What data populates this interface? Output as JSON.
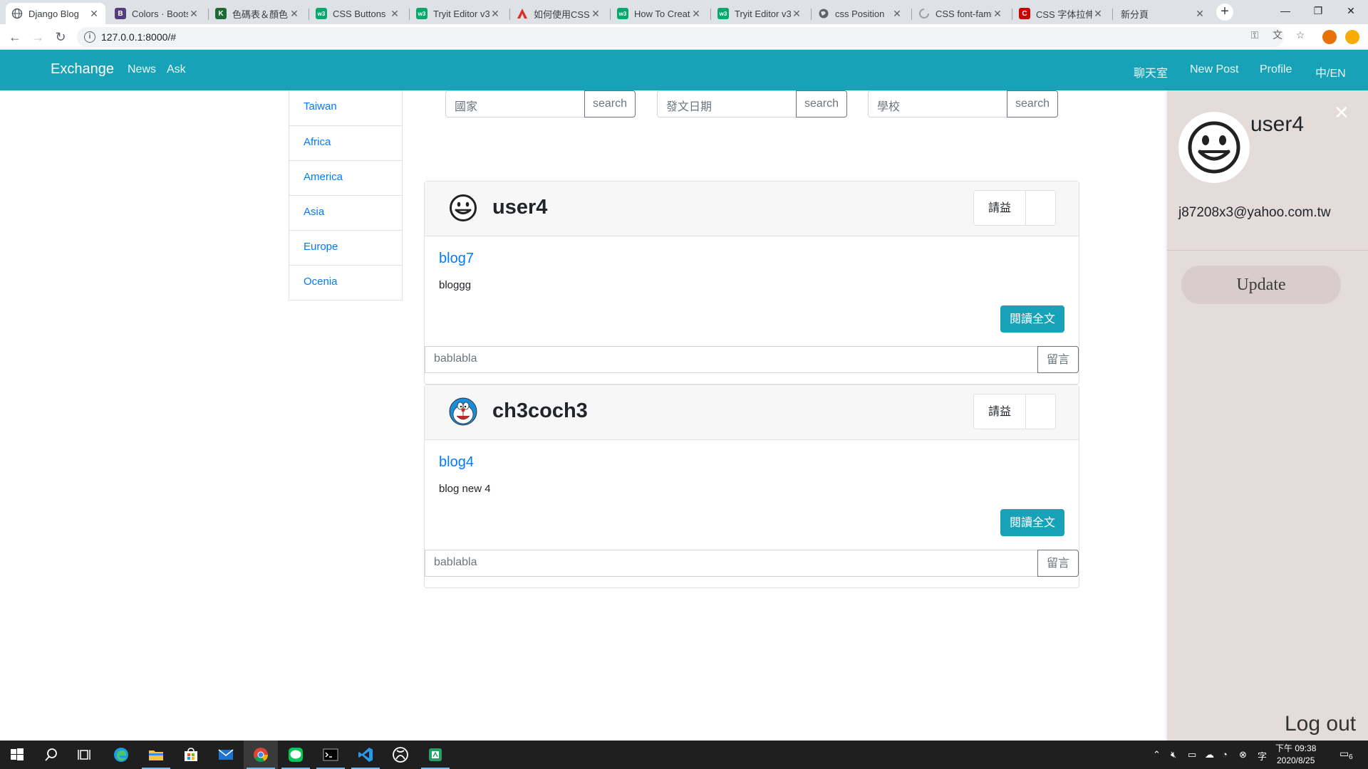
{
  "browser": {
    "tabs": [
      {
        "label": "Django Blog",
        "favicon": "globe-icon",
        "color": "#5f6368"
      },
      {
        "label": "Colors · Bootstrap",
        "favicon": "bootstrap-icon",
        "color": "#563d7c"
      },
      {
        "label": "色碼表＆顏色",
        "favicon": "k-icon",
        "color": "#1d6b34"
      },
      {
        "label": "CSS Buttons",
        "favicon": "w3-icon",
        "color": "#04aa6d"
      },
      {
        "label": "Tryit Editor v3",
        "favicon": "w3-icon",
        "color": "#04aa6d"
      },
      {
        "label": "如何使用CSS",
        "favicon": "triangle-icon",
        "color": "#d93025"
      },
      {
        "label": "How To Create",
        "favicon": "w3-icon",
        "color": "#04aa6d"
      },
      {
        "label": "Tryit Editor v3",
        "favicon": "w3-icon",
        "color": "#04aa6d"
      },
      {
        "label": "css Position",
        "favicon": "globe-icon",
        "color": "#5f6368"
      },
      {
        "label": "CSS font-family",
        "favicon": "loading-icon",
        "color": "#9aa0a6"
      },
      {
        "label": "CSS 字体拉伸",
        "favicon": "c-icon",
        "color": "#c00"
      },
      {
        "label": "新分頁",
        "favicon": "",
        "color": ""
      }
    ],
    "url": "127.0.0.1:8000/#"
  },
  "navbar": {
    "brand": "Exchange",
    "left_links": [
      "News",
      "Ask"
    ],
    "right_links": [
      "聊天室",
      "New Post",
      "Profile",
      "中/EN"
    ]
  },
  "regions": [
    "Taiwan",
    "Africa",
    "America",
    "Asia",
    "Europe",
    "Ocenia"
  ],
  "search": [
    {
      "placeholder": "國家",
      "button": "search"
    },
    {
      "placeholder": "發文日期",
      "button": "search"
    },
    {
      "placeholder": "學校",
      "button": "search"
    }
  ],
  "posts": [
    {
      "author": "user4",
      "avatar": "smiley-icon",
      "ask_label": "請益",
      "title": "blog7",
      "body": "bloggg",
      "read_more": "閱讀全文",
      "comment_placeholder": "bablabla",
      "comment_button": "留言"
    },
    {
      "author": "ch3coch3",
      "avatar": "doraemon-avatar",
      "ask_label": "請益",
      "title": "blog4",
      "body": "blog new 4",
      "read_more": "閱讀全文",
      "comment_placeholder": "bablabla",
      "comment_button": "留言"
    }
  ],
  "profile_panel": {
    "close": "✕",
    "username": "user4",
    "email": "j87208x3@yahoo.com.tw",
    "update": "Update",
    "logout": "Log out"
  },
  "taskbar": {
    "time": "下午 09:38",
    "date": "2020/8/25",
    "notifications": "6"
  },
  "colors": {
    "accent": "#17a2b8",
    "link": "#007bff",
    "panel": "#e4dbdb"
  }
}
